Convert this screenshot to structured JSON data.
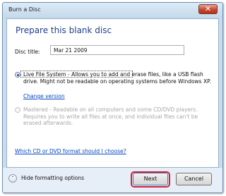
{
  "window": {
    "title": "Burn a Disc",
    "close_glyph": "✕"
  },
  "main": {
    "heading": "Prepare this blank disc",
    "disc_title_label": "Disc title:",
    "disc_title_value": "Mar 21 2009",
    "options": [
      {
        "text": "Live File System - Allows you to add and erase files, like a USB flash drive. Might not be readable on operating systems before Windows XP.",
        "selected": true,
        "enabled": true
      },
      {
        "text": "Mastered - Readable on all computers and some CD/DVD players. Requires you to write all files at once, and individual files can't be erased afterwards.",
        "selected": false,
        "enabled": false
      }
    ],
    "change_version_link": "Change version",
    "help_link": "Which CD or DVD format should I choose?"
  },
  "footer": {
    "toggle_label": "Hide formatting options",
    "toggle_glyph": "⌃",
    "next_label": "Next",
    "cancel_label": "Cancel"
  },
  "colors": {
    "heading": "#1e3f8f",
    "link": "#0645c4",
    "highlight": "#d4213a",
    "close_button": "#c7472f"
  }
}
